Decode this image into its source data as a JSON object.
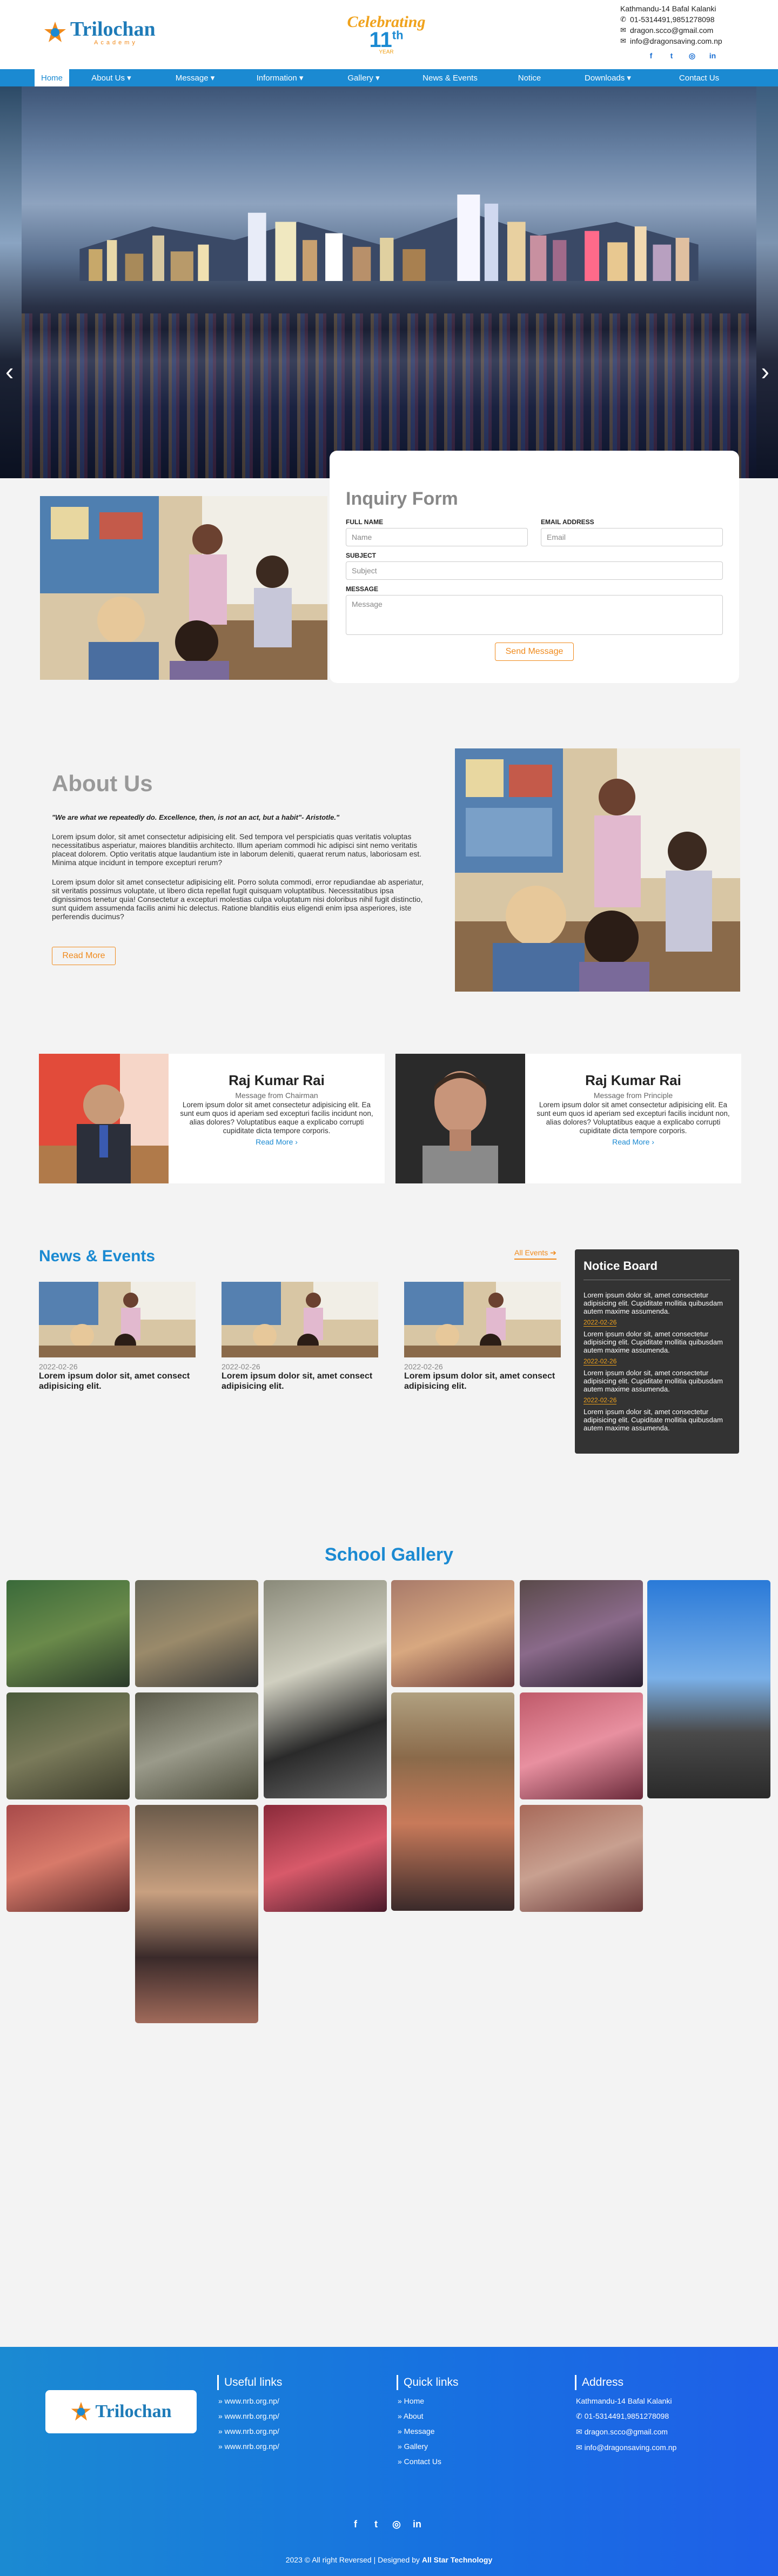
{
  "header": {
    "logo_name": "Trilochan",
    "logo_sub": "Academy",
    "celebrate_word": "Celebrating",
    "celebrate_num": "11",
    "celebrate_sup": "th",
    "celebrate_years": "YEAR",
    "address": "Kathmandu-14 Bafal Kalanki",
    "phone": "01-5314491,9851278098",
    "email1": "dragon.scco@gmail.com",
    "email2": "info@dragonsaving.com.np"
  },
  "nav": [
    {
      "label": "Home"
    },
    {
      "label": "About Us ▾"
    },
    {
      "label": "Message ▾"
    },
    {
      "label": "Information ▾"
    },
    {
      "label": "Gallery ▾"
    },
    {
      "label": "News & Events"
    },
    {
      "label": "Notice"
    },
    {
      "label": "Downloads ▾"
    },
    {
      "label": "Contact Us"
    }
  ],
  "inquiry": {
    "title": "Inquiry Form",
    "full_name_label": "FULL NAME",
    "full_name_placeholder": "Name",
    "email_label": "EMAIL ADDRESS",
    "email_placeholder": "Email",
    "subject_label": "SUBJECT",
    "subject_placeholder": "Subject",
    "message_label": "MESSAGE",
    "message_placeholder": "Message",
    "send_label": "Send Message"
  },
  "about": {
    "title": "About Us",
    "quote": "\"We are what we repeatedly do. Excellence, then, is not an act, but a habit\"- Aristotle.\"",
    "p1": "Lorem ipsum dolor, sit amet consectetur adipisicing elit. Sed tempora vel perspiciatis quas veritatis voluptas necessitatibus asperiatur, maiores blanditiis architecto. Illum aperiam commodi hic adipisci sint nemo veritatis placeat dolorem. Optio veritatis atque laudantium iste in laborum deleniti, quaerat rerum natus, laboriosam est. Minima atque incidunt in tempore excepturi rerum?",
    "p2": "Lorem ipsum dolor sit amet consectetur adipisicing elit. Porro soluta commodi, error repudiandae ab asperiatur, sit veritatis possimus voluptate, ut libero dicta repellat fugit quisquam voluptatibus. Necessitatibus ipsa dignissimos tenetur quia! Consectetur a excepturi molestias culpa voluptatum nisi doloribus nihil fugit distinctio, sunt quidem assumenda facilis animi hic delectus. Ratione blanditiis eius eligendi enim ipsa asperiores, iste perferendis ducimus?",
    "read_more": "Read More"
  },
  "messages": [
    {
      "name": "Raj Kumar Rai",
      "role": "Message from Chairman",
      "text": "Lorem ipsum dolor sit amet consectetur adipisicing elit. Ea sunt eum quos id aperiam sed excepturi facilis incidunt non, alias dolores? Voluptatibus eaque a explicabo corrupti cupiditate dicta tempore corporis.",
      "link": "Read More ›"
    },
    {
      "name": "Raj Kumar Rai",
      "role": "Message from Principle",
      "text": "Lorem ipsum dolor sit amet consectetur adipisicing elit. Ea sunt eum quos id aperiam sed excepturi facilis incidunt non, alias dolores? Voluptatibus eaque a explicabo corrupti cupiditate dicta tempore corporis.",
      "link": "Read More ›"
    }
  ],
  "news": {
    "title": "News & Events",
    "all_events": "All Events ➔",
    "items": [
      {
        "date": "2022-02-26",
        "title": "Lorem ipsum dolor sit, amet consect adipisicing elit."
      },
      {
        "date": "2022-02-26",
        "title": "Lorem ipsum dolor sit, amet consect adipisicing elit."
      },
      {
        "date": "2022-02-26",
        "title": "Lorem ipsum dolor sit, amet consect adipisicing elit."
      }
    ]
  },
  "notice": {
    "title": "Notice Board",
    "items": [
      {
        "text": "Lorem ipsum dolor sit, amet consectetur adipisicing elit. Cupiditate mollitia quibusdam autem maxime assumenda.",
        "date": "2022-02-26"
      },
      {
        "text": "Lorem ipsum dolor sit, amet consectetur adipisicing elit. Cupiditate mollitia quibusdam autem maxime assumenda.",
        "date": "2022-02-26"
      },
      {
        "text": "Lorem ipsum dolor sit, amet consectetur adipisicing elit. Cupiditate mollitia quibusdam autem maxime assumenda.",
        "date": "2022-02-26"
      },
      {
        "text": "Lorem ipsum dolor sit, amet consectetur adipisicing elit. Cupiditate mollitia quibusdam autem maxime assumenda.",
        "date": ""
      }
    ]
  },
  "gallery": {
    "title": "School Gallery"
  },
  "footer": {
    "useful_title": "Useful links",
    "useful_links": [
      "» www.nrb.org.np/",
      "» www.nrb.org.np/",
      "» www.nrb.org.np/",
      "» www.nrb.org.np/"
    ],
    "quick_title": "Quick links",
    "quick_links": [
      "» Home",
      "» About",
      "» Message",
      "» Gallery",
      "» Contact Us"
    ],
    "address_title": "Address",
    "address": "Kathmandu-14 Bafal Kalanki",
    "phone": "✆ 01-5314491,9851278098",
    "email1": "✉ dragon.scco@gmail.com",
    "email2": "✉ info@dragonsaving.com.np",
    "copyright_pre": "2023 © All right Reversed | Designed by",
    "designer": "All Star Technology"
  },
  "colors": {
    "primary": "#1b8ad2",
    "accent": "#f08a1c",
    "notice_bg": "#333333"
  }
}
